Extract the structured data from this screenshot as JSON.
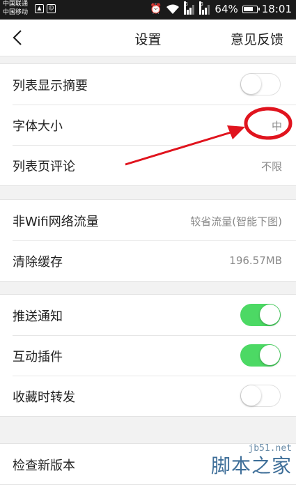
{
  "status_bar": {
    "carrier_1": "中国联通",
    "carrier_2": "中国移动",
    "battery": "64%",
    "time": "18:01"
  },
  "nav": {
    "title": "设置",
    "feedback": "意见反馈"
  },
  "groups": [
    {
      "rows": [
        {
          "label": "列表显示摘要",
          "type": "toggle",
          "on": false
        },
        {
          "label": "字体大小",
          "type": "value",
          "value": "中"
        },
        {
          "label": "列表页评论",
          "type": "value",
          "value": "不限"
        }
      ]
    },
    {
      "rows": [
        {
          "label": "非Wifi网络流量",
          "type": "value",
          "value": "较省流量(智能下图)"
        },
        {
          "label": "清除缓存",
          "type": "value",
          "value": "196.57MB"
        }
      ]
    },
    {
      "rows": [
        {
          "label": "推送通知",
          "type": "toggle",
          "on": true
        },
        {
          "label": "互动插件",
          "type": "toggle",
          "on": true
        },
        {
          "label": "收藏时转发",
          "type": "toggle",
          "on": false
        }
      ]
    },
    {
      "rows": [
        {
          "label": "检查新版本",
          "type": "none"
        }
      ]
    }
  ],
  "watermark": {
    "url": "jb51.net",
    "text": "脚本之家"
  },
  "colors": {
    "toggle_on": "#4cd964",
    "annotation": "#e0141e"
  }
}
